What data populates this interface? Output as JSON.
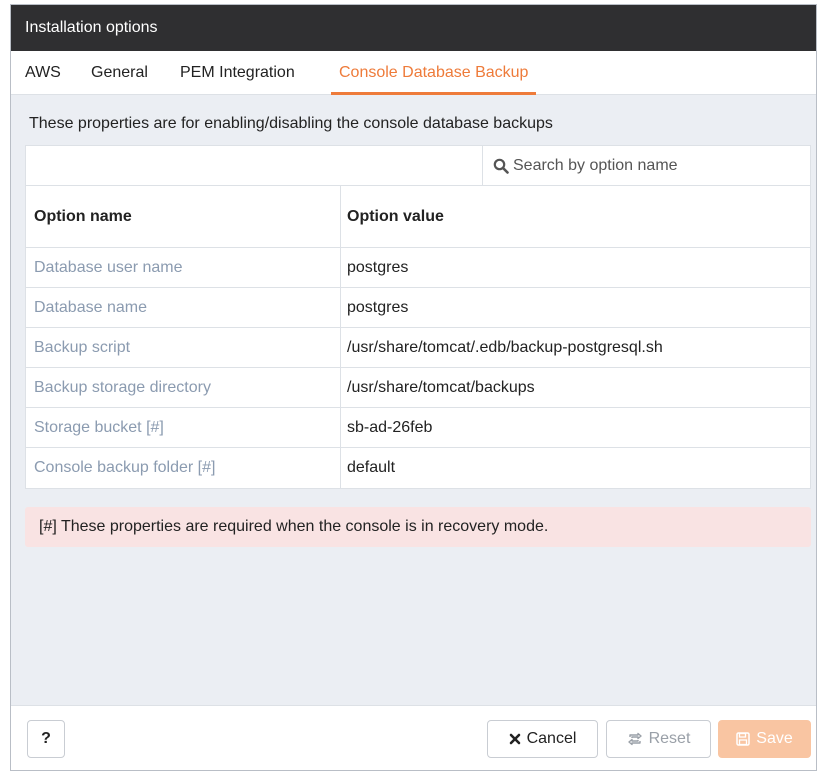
{
  "dialog": {
    "title": "Installation options"
  },
  "tabs": [
    {
      "label": "AWS",
      "active": false
    },
    {
      "label": "General",
      "active": false
    },
    {
      "label": "PEM Integration",
      "active": false
    },
    {
      "label": "Console Database Backup",
      "active": true
    }
  ],
  "description": "These properties are for enabling/disabling the console database backups",
  "search": {
    "placeholder": "Search by option name",
    "value": ""
  },
  "table": {
    "headers": [
      "Option name",
      "Option value"
    ],
    "rows": [
      {
        "name": "Database user name",
        "value": "postgres"
      },
      {
        "name": "Database name",
        "value": "postgres"
      },
      {
        "name": "Backup script",
        "value": "/usr/share/tomcat/.edb/backup-postgresql.sh"
      },
      {
        "name": "Backup storage directory",
        "value": "/usr/share/tomcat/backups"
      },
      {
        "name": "Storage bucket [#]",
        "value": "sb-ad-26feb"
      },
      {
        "name": "Console backup folder [#]",
        "value": "default"
      }
    ]
  },
  "note": "[#] These properties are required when the console is in recovery mode.",
  "footer": {
    "help_label": "?",
    "cancel_label": "Cancel",
    "reset_label": "Reset",
    "save_label": "Save"
  },
  "colors": {
    "accent": "#ee7b3a",
    "titlebar": "#2f2f31",
    "alert_bg": "#f9e3e3",
    "save_disabled": "#f9c5a2"
  },
  "icons": {
    "search": "search-icon",
    "cancel": "close-icon",
    "reset": "recycle-icon",
    "save": "save-icon"
  }
}
